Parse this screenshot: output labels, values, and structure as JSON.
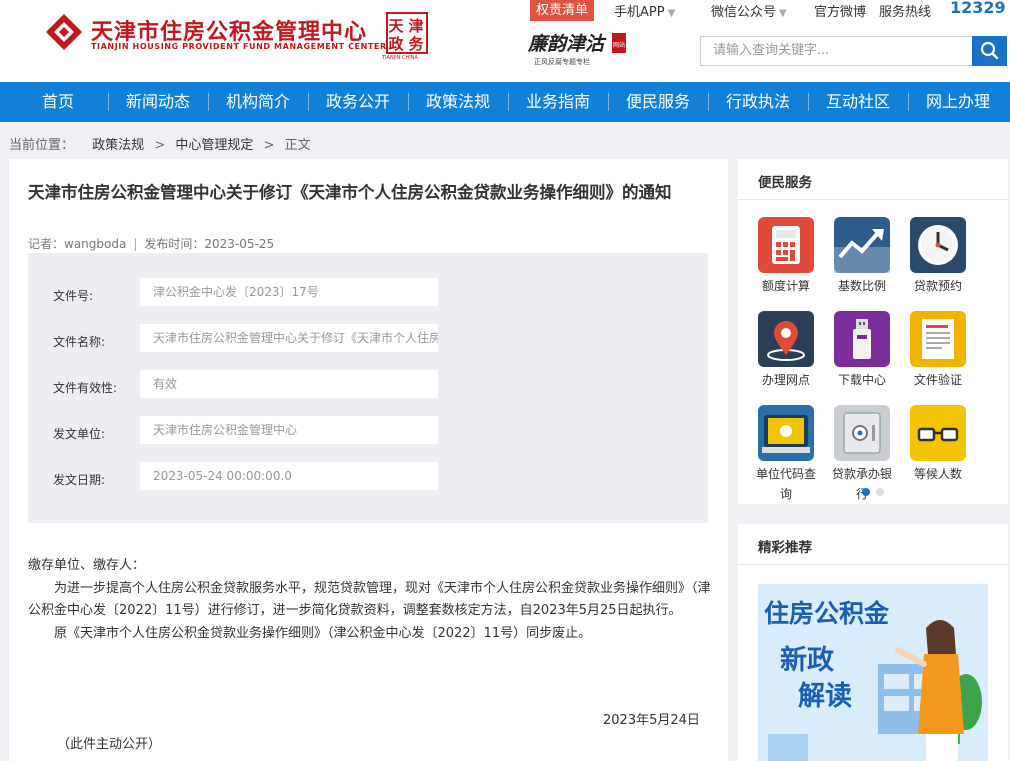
{
  "header": {
    "org_name_cn": "天津市住房公积金管理中心",
    "org_name_en": "TIANJIN HOUSING PROVIDENT FUND MANAGEMENT CENTER",
    "seal_chars": [
      "天",
      "津",
      "政",
      "务"
    ],
    "seal_caption": "TIANJIN·CHINA",
    "brand_label": "廉韵津沽",
    "brand_caption": "正风反腐专题专栏",
    "brand_tag": "网站",
    "topbar": {
      "badge": "权责清单",
      "mobile_app": "手机APP",
      "wechat": "微信公众号",
      "weibo": "官方微博",
      "hotline_label": "服务热线",
      "hotline_number": "12329"
    },
    "search_placeholder": "请输入查询关键字..."
  },
  "nav": [
    "首页",
    "新闻动态",
    "机构简介",
    "政务公开",
    "政策法规",
    "业务指南",
    "便民服务",
    "行政执法",
    "互动社区",
    "网上办理"
  ],
  "breadcrumb": {
    "prefix": "当前位置：",
    "items": [
      "政策法规",
      "中心管理规定",
      "正文"
    ],
    "separator": ">"
  },
  "article": {
    "title": "天津市住房公积金管理中心关于修订《天津市个人住房公积金贷款业务操作细则》的通知",
    "author_label": "记者：wangboda",
    "publish_label": "发布时间：2023-05-25",
    "fields": [
      {
        "label": "文件号:",
        "value": "津公积金中心发〔2023〕17号"
      },
      {
        "label": "文件名称:",
        "value": "天津市住房公积金管理中心关于修订《天津市个人住房公积金贷款业务操作细则》的通知"
      },
      {
        "label": "文件有效性:",
        "value": "有效"
      },
      {
        "label": "发文单位:",
        "value": "天津市住房公积金管理中心"
      },
      {
        "label": "发文日期:",
        "value": "2023-05-24 00:00:00.0"
      }
    ],
    "salutation": "缴存单位、缴存人：",
    "para1": "为进一步提高个人住房公积金贷款服务水平，规范贷款管理，现对《天津市个人住房公积金贷款业务操作细则》（津公积金中心发〔2022〕11号）进行修订，进一步简化贷款资料，调整套数核定方法，自2023年5月25日起执行。",
    "para2": "原《天津市个人住房公积金贷款业务操作细则》（津公积金中心发〔2022〕11号）同步废止。",
    "date": "2023年5月24日",
    "public_note": "（此件主动公开）"
  },
  "services": {
    "title": "便民服务",
    "items": [
      {
        "label": "额度计算",
        "icon": "calculator-icon",
        "color": "#e04a3a"
      },
      {
        "label": "基数比例",
        "icon": "trend-chart-icon",
        "color": "#2f5d8a"
      },
      {
        "label": "贷款预约",
        "icon": "clock-icon",
        "color": "#2b4a6b"
      },
      {
        "label": "办理网点",
        "icon": "location-pin-icon",
        "color": "#2a3f55"
      },
      {
        "label": "下载中心",
        "icon": "usb-drive-icon",
        "color": "#7a2e9a"
      },
      {
        "label": "文件验证",
        "icon": "document-check-icon",
        "color": "#f0b400"
      },
      {
        "label": "单位代码查询",
        "icon": "tablet-icon",
        "color": "#2a6fa8"
      },
      {
        "label": "贷款承办银行",
        "icon": "safe-icon",
        "color": "#c9cdd2"
      },
      {
        "label": "等候人数",
        "icon": "glasses-icon",
        "color": "#f3c400"
      }
    ]
  },
  "recommend": {
    "title": "精彩推荐",
    "promo_line1": "住房公积金",
    "promo_line2": "新政",
    "promo_line3": "解读"
  },
  "colors": {
    "primary": "#1380d8",
    "brand_red": "#c4161c",
    "badge": "#e15241"
  }
}
